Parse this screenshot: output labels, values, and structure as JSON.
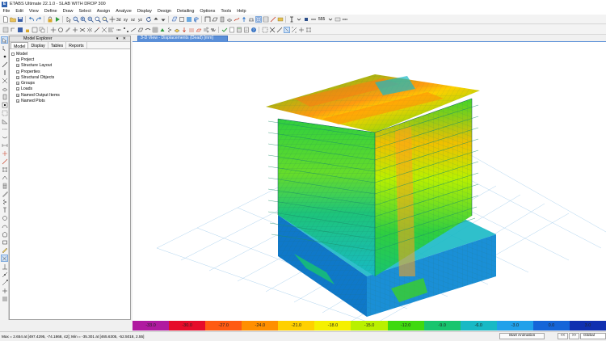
{
  "window": {
    "title": "ETABS Ultimate 22.1.0 - SLAB WITH DROP 300",
    "app_icon": "E"
  },
  "menu": [
    "File",
    "Edit",
    "View",
    "Define",
    "Draw",
    "Select",
    "Assign",
    "Analyze",
    "Display",
    "Design",
    "Detailing",
    "Options",
    "Tools",
    "Help"
  ],
  "toolbar_top": {
    "zoom_label": "Ї",
    "dim_text": "555"
  },
  "explorer": {
    "title": "Model Explorer",
    "header_controls": "▾ ✕",
    "tabs": [
      "Model",
      "Display",
      "Tables",
      "Reports"
    ],
    "root": "Model",
    "items": [
      "Project",
      "Structure Layout",
      "Properties",
      "Structural Objects",
      "Groups",
      "Loads",
      "Named Output Items",
      "Named Plots"
    ]
  },
  "view": {
    "tab_title": "3-D View  -  Displacements (Dead)  [mm]"
  },
  "colorbar": {
    "colors": [
      "#b01aa0",
      "#e60c2a",
      "#ff5a12",
      "#ff8f00",
      "#ffd000",
      "#f5f000",
      "#b9f000",
      "#3fd90f",
      "#18c56e",
      "#18b9c5",
      "#20a1ea",
      "#1565d8",
      "#1030b0"
    ],
    "ticks": [
      "-33.0",
      "-30.0",
      "-27.0",
      "-24.0",
      "-21.0",
      "-18.0",
      "-15.0",
      "-12.0",
      "-9.0",
      "-6.0",
      "-3.0",
      "0.0",
      "3.0"
    ]
  },
  "status": {
    "text": "Max = 2.654 at [497.4295, -74.1868, 42]; Min = -35.301 at [465.6305, -52.5018, 2.55]",
    "animation_button": "Start Animation",
    "prev": "<<",
    "next": ">>",
    "coord_system": "Global"
  }
}
